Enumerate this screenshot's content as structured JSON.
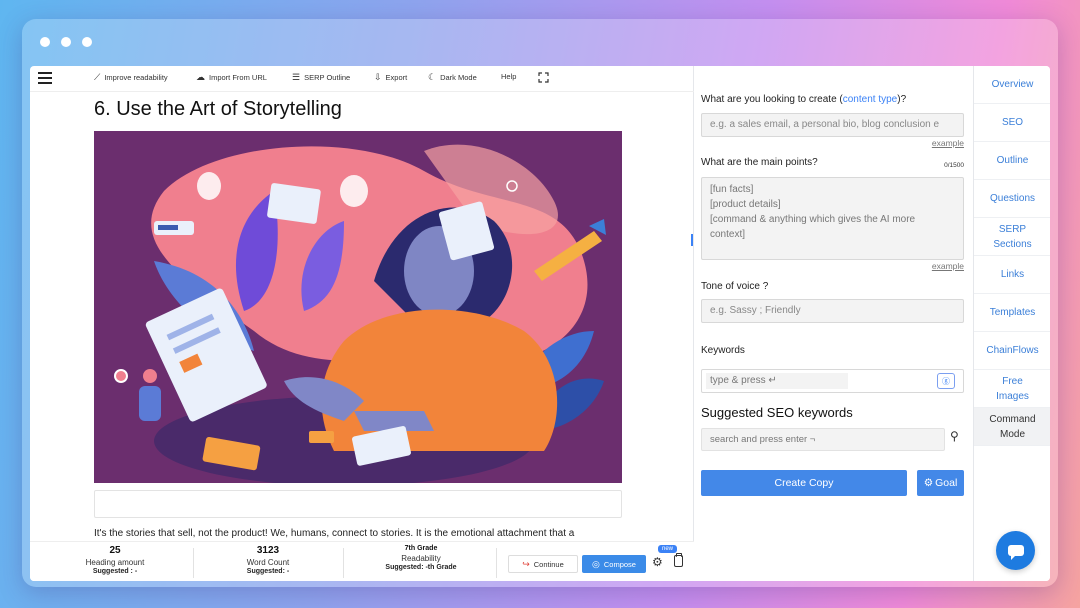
{
  "toolbar": {
    "improve": "Improve readability",
    "import": "Import From URL",
    "serp": "SERP Outline",
    "export": "Export",
    "dark": "Dark Mode",
    "help": "Help"
  },
  "editor": {
    "heading": "6. Use the Art of Storytelling",
    "paragraph": "It's the stories that sell, not the product! We, humans, connect to stories. It is the emotional attachment that a"
  },
  "stats": {
    "heading_amount": {
      "value": "25",
      "label": "Heading amount",
      "suggested": "Suggested : -"
    },
    "word_count": {
      "value": "3123",
      "label": "Word Count",
      "suggested": "Suggested: -"
    },
    "readability": {
      "value": "7th Grade",
      "label": "Readability",
      "suggested": "Suggested: -th Grade"
    }
  },
  "actions": {
    "continue": "Continue",
    "compose": "Compose",
    "new_badge": "new"
  },
  "form": {
    "content_type_label_pre": "What are you looking to create (",
    "content_type_label_accent": "content type",
    "content_type_label_post": ")?",
    "content_type_placeholder": "e.g. a sales email, a personal bio, blog conclusion e",
    "example": "example",
    "main_points_label": "What are the main points?",
    "main_points_counter": "0/1500",
    "main_points_lines": [
      "[fun facts]",
      "[product details]",
      "[command & anything which gives the AI more",
      "context]"
    ],
    "tone_label": "Tone of voice ?",
    "tone_placeholder": "e.g. Sassy ; Friendly",
    "keywords_label": "Keywords",
    "keywords_placeholder": "type &  press ↵",
    "seo_title": "Suggested SEO keywords",
    "seo_placeholder": "search and press enter ¬",
    "create_copy": "Create Copy",
    "goal": "Goal"
  },
  "nav": {
    "items": [
      "Overview",
      "SEO",
      "Outline",
      "Questions",
      "SERP Sections",
      "Links",
      "Templates",
      "ChainFlows",
      "Free Images",
      "Command Mode"
    ],
    "active": "Command Mode"
  },
  "colors": {
    "accent": "#3b82f6",
    "button": "#4388e8",
    "illustration_bg": "#6b2e6e"
  }
}
